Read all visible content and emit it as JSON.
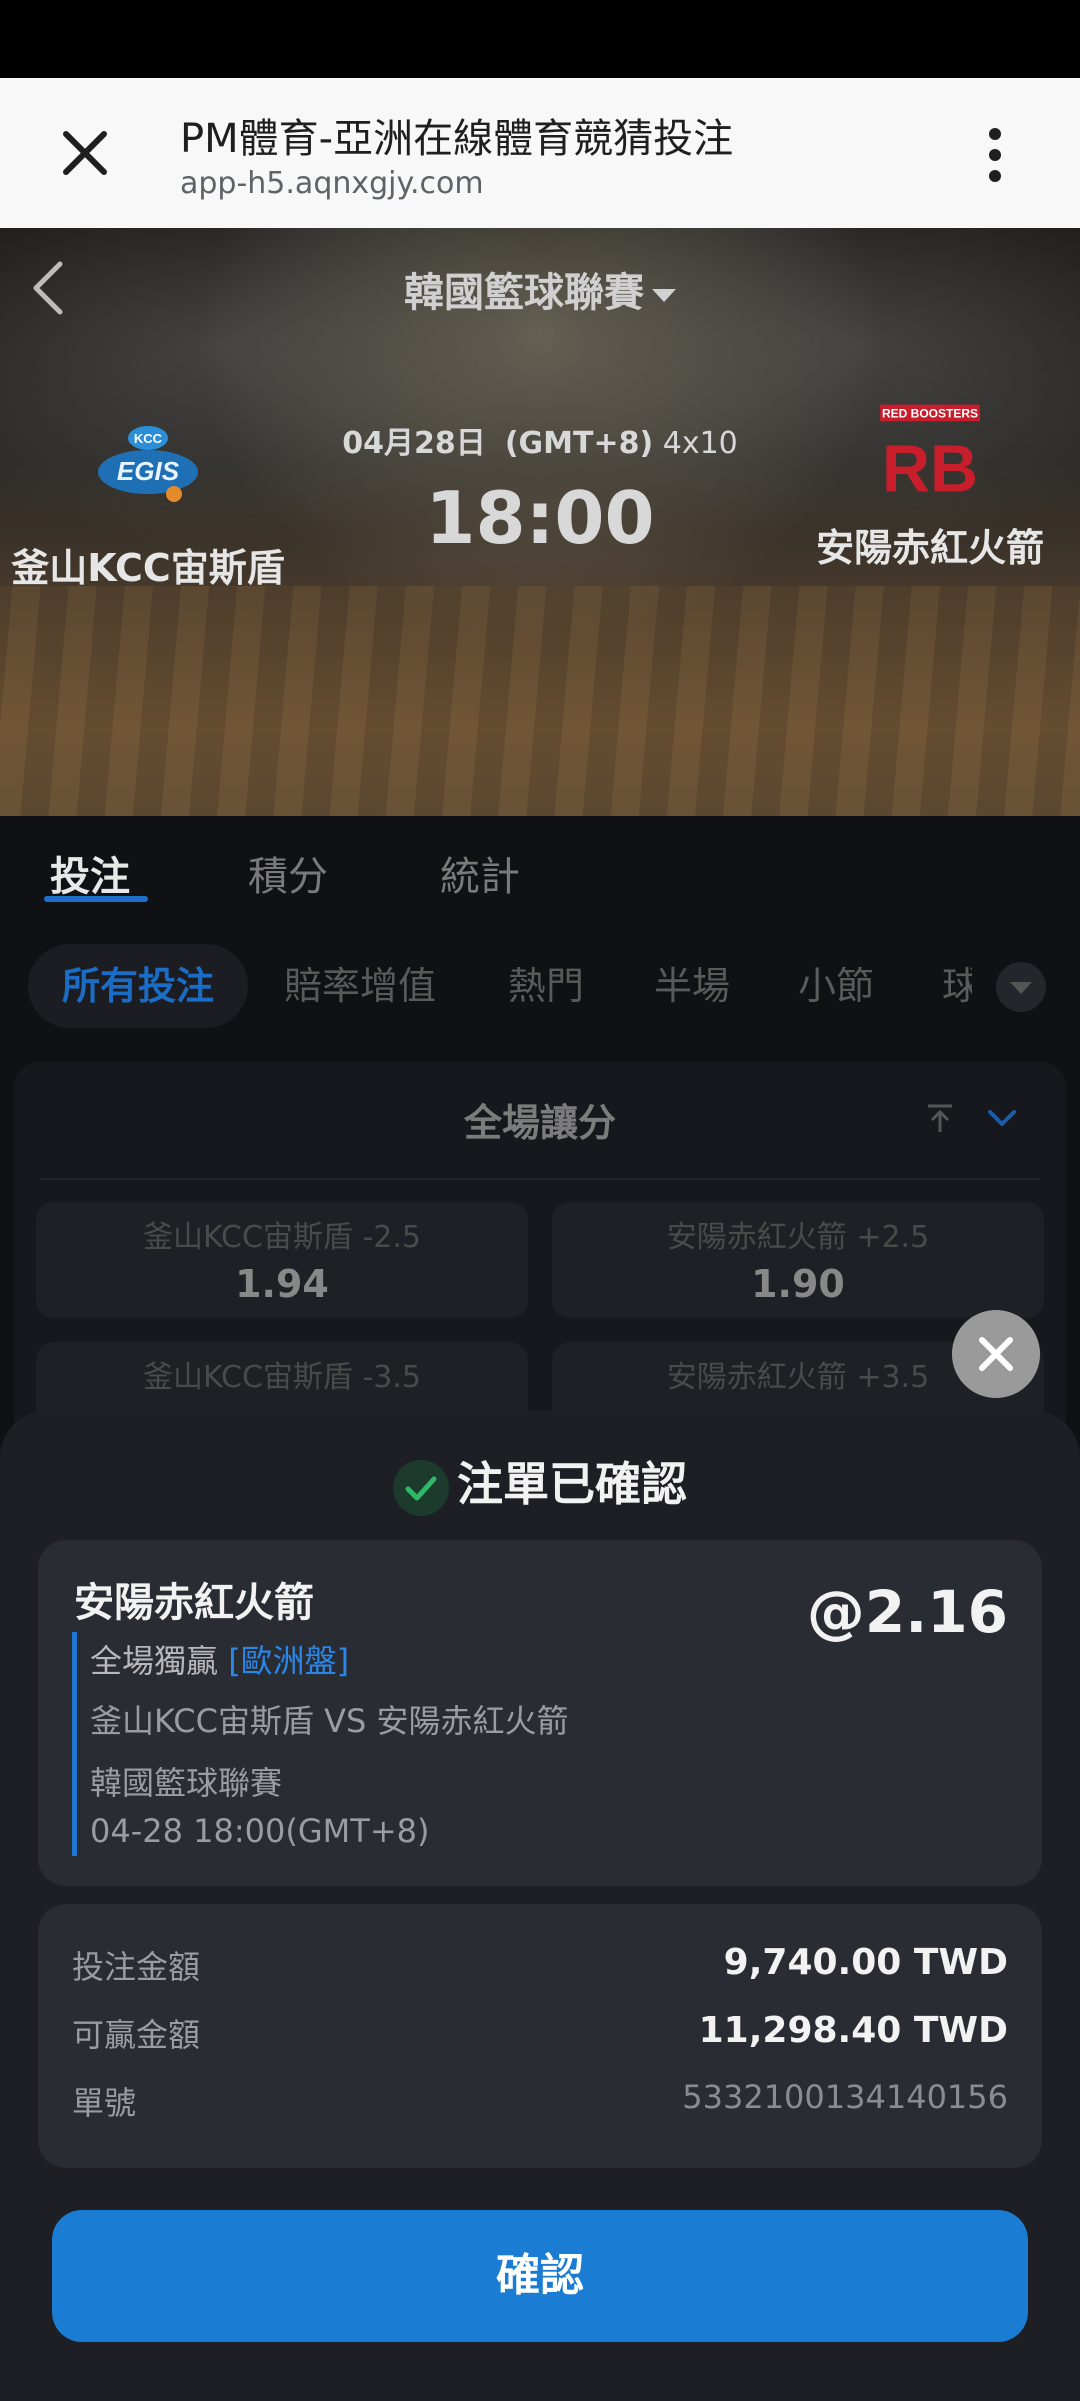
{
  "browser": {
    "title": "PM體育-亞洲在線體育競猜投注",
    "url": "app-h5.aqnxgjy.com"
  },
  "match": {
    "league": "韓國籃球聯賽",
    "date": "04月28日",
    "timezone": "(GMT+8)",
    "format": "4x10",
    "time": "18:00",
    "home_team": "釜山KCC宙斯盾",
    "home_logo_text": "KCC EGIS",
    "away_team": "安陽赤紅火箭",
    "away_logo_text": "RED BOOSTERS RB"
  },
  "tabs": [
    {
      "label": "投注",
      "active": true
    },
    {
      "label": "積分",
      "active": false
    },
    {
      "label": "統計",
      "active": false
    }
  ],
  "filters": [
    "所有投注",
    "賠率增值",
    "熱門",
    "半場",
    "小節",
    "球"
  ],
  "market": {
    "title": "全場讓分",
    "odds": [
      {
        "label": "釜山KCC宙斯盾 -2.5",
        "value": "1.94"
      },
      {
        "label": "安陽赤紅火箭 +2.5",
        "value": "1.90"
      },
      {
        "label": "釜山KCC宙斯盾 -3.5",
        "value": ""
      },
      {
        "label": "安陽赤紅火箭 +3.5",
        "value": ""
      }
    ]
  },
  "confirmation": {
    "status": "注單已確認",
    "selection": "安陽赤紅火箭",
    "price": "@2.16",
    "market_name": "全場獨贏",
    "market_tag": "[歐洲盤]",
    "fixture": "釜山KCC宙斯盾 VS 安陽赤紅火箭",
    "league": "韓國籃球聯賽",
    "kickoff": "04-28 18:00(GMT+8)",
    "stake_label": "投注金額",
    "stake_value": "9,740.00 TWD",
    "payout_label": "可贏金額",
    "payout_value": "11,298.40 TWD",
    "ticket_label": "單號",
    "ticket_value": "5332100134140156",
    "confirm_button": "確認"
  },
  "colors": {
    "accent": "#1a7cd2",
    "tag_blue": "#2a86e8",
    "success": "#2fb86a",
    "sheet_bg": "#1e1f25",
    "card_bg": "#2a2c33"
  }
}
